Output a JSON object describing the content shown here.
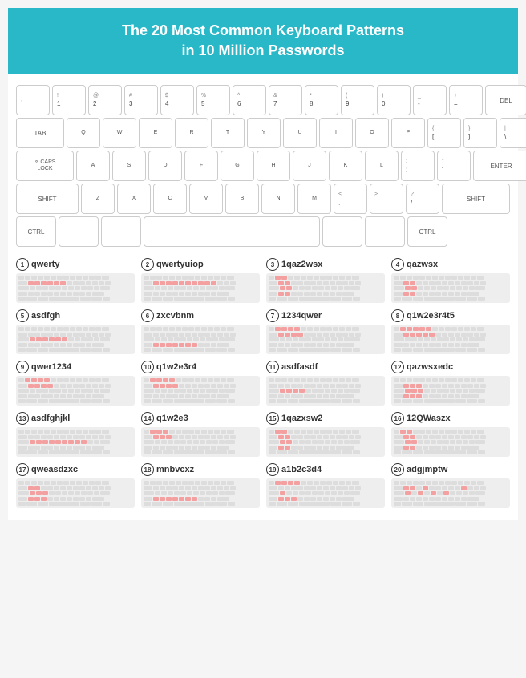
{
  "header": {
    "line1": "The 20 Most Common Keyboard Patterns",
    "line2": "in 10 Million Passwords"
  },
  "keyboard": {
    "row1": [
      {
        "top": "-",
        "bot": ""
      },
      {
        "top": "!",
        "bot": "1"
      },
      {
        "top": "@",
        "bot": "2"
      },
      {
        "top": "#",
        "bot": "3"
      },
      {
        "top": "$",
        "bot": "4"
      },
      {
        "top": "%",
        "bot": "5"
      },
      {
        "top": "^",
        "bot": "6"
      },
      {
        "top": "&",
        "bot": "7"
      },
      {
        "top": "*",
        "bot": "8"
      },
      {
        "top": "(",
        "bot": "9"
      },
      {
        "top": ")",
        "bot": "0"
      },
      {
        "top": "",
        "bot": "="
      },
      {
        "top": "+",
        "bot": "="
      },
      {
        "special": "DEL"
      }
    ],
    "row2_label": "TAB",
    "row3_label": "CAPS LOCK",
    "row4_label": "SHIFT",
    "row5_label": "CTRL"
  },
  "patterns": [
    {
      "num": 1,
      "name": "qwerty",
      "keys": [
        [
          0,
          1,
          2,
          3,
          4,
          5
        ],
        [],
        [],
        [],
        []
      ]
    },
    {
      "num": 2,
      "name": "qwertyuiop",
      "keys": [
        [
          0,
          1,
          2,
          3,
          4,
          5,
          6,
          7,
          8,
          9
        ],
        [],
        [],
        [],
        []
      ]
    },
    {
      "num": 3,
      "name": "1qaz2wsx",
      "keys": []
    },
    {
      "num": 4,
      "name": "qazwsx",
      "keys": []
    },
    {
      "num": 5,
      "name": "asdfgh",
      "keys": []
    },
    {
      "num": 6,
      "name": "zxcvbnm",
      "keys": []
    },
    {
      "num": 7,
      "name": "1234qwer",
      "keys": []
    },
    {
      "num": 8,
      "name": "q1w2e3r4t5",
      "keys": []
    },
    {
      "num": 9,
      "name": "qwer1234",
      "keys": []
    },
    {
      "num": 10,
      "name": "q1w2e3r4",
      "keys": []
    },
    {
      "num": 11,
      "name": "asdfasdf",
      "keys": []
    },
    {
      "num": 12,
      "name": "qazwsxedc",
      "keys": []
    },
    {
      "num": 13,
      "name": "asdfghjkl",
      "keys": []
    },
    {
      "num": 14,
      "name": "q1w2e3",
      "keys": []
    },
    {
      "num": 15,
      "name": "1qazxsw2",
      "keys": []
    },
    {
      "num": 16,
      "name": "12QWaszx",
      "keys": []
    },
    {
      "num": 17,
      "name": "qweasdzxc",
      "keys": []
    },
    {
      "num": 18,
      "name": "mnbvcxz",
      "keys": []
    },
    {
      "num": 19,
      "name": "a1b2c3d4",
      "keys": []
    },
    {
      "num": 20,
      "name": "adgjmptw",
      "keys": []
    }
  ]
}
